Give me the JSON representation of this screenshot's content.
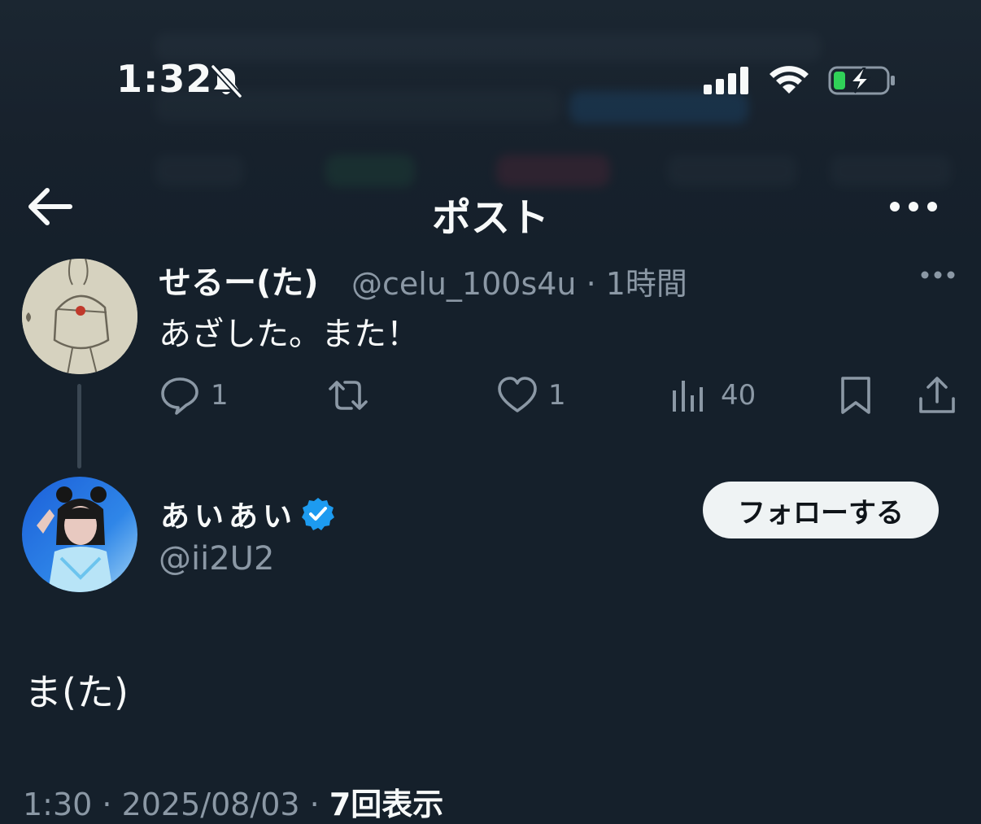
{
  "status_bar": {
    "time": "1:32",
    "silent_icon": "bell-slash-icon",
    "signal_icon": "cellular-signal-icon",
    "wifi_icon": "wifi-icon",
    "battery_icon": "battery-charging-icon",
    "battery_color": "#30d158"
  },
  "nav": {
    "back_icon": "arrow-left-icon",
    "title": "ポスト",
    "more_icon": "more-horizontal-icon"
  },
  "parent_post": {
    "display_name": "せるー(た)",
    "handle_time": "@celu_100s4u · 1時間",
    "text": "あざした。また！",
    "actions": {
      "reply_count": "1",
      "like_count": "1",
      "views_count": "40"
    }
  },
  "main_post": {
    "display_name": "あいあい",
    "verified_color": "#1d9bf0",
    "handle": "@ii2U2",
    "follow_label": "フォローする",
    "text": "ま(た)",
    "footer_time": "1:30 · 2025/08/03 · ",
    "footer_views": "7回表示"
  }
}
